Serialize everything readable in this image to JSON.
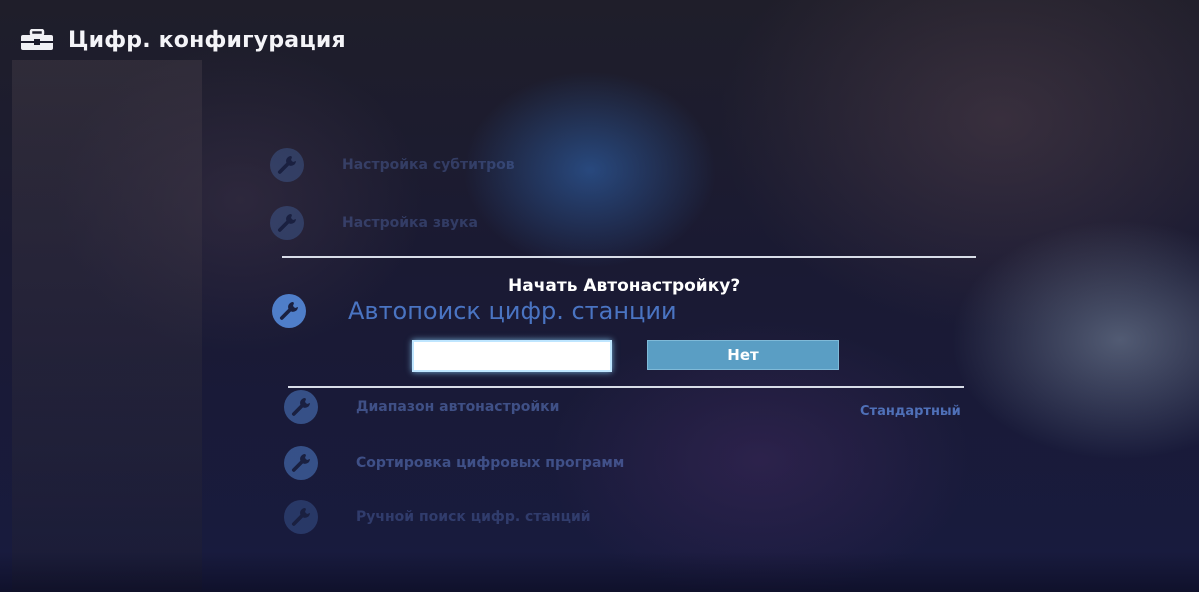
{
  "header": {
    "title": "Цифр. конфигурация",
    "icon": "toolbox-icon"
  },
  "menu": {
    "items": [
      {
        "label": "Настройка субтитров",
        "icon": "wrench-icon"
      },
      {
        "label": "Настройка звука",
        "icon": "wrench-icon"
      },
      {
        "label": "Автопоиск цифр. станции",
        "icon": "wrench-icon"
      },
      {
        "label": "Диапазон автонастройки",
        "value": "Стандартный",
        "icon": "wrench-icon"
      },
      {
        "label": "Сортировка цифровых программ",
        "icon": "wrench-icon"
      },
      {
        "label": "Ручной поиск цифр. станций",
        "icon": "wrench-icon"
      }
    ]
  },
  "dialog": {
    "title": "Начать Автонастройку?",
    "yes_label": "",
    "no_label": "Нет"
  },
  "colors": {
    "accent": "#4f7ec9",
    "button_no": "#5a9ec4",
    "button_focus": "#ffffff",
    "text": "#ffffff"
  }
}
